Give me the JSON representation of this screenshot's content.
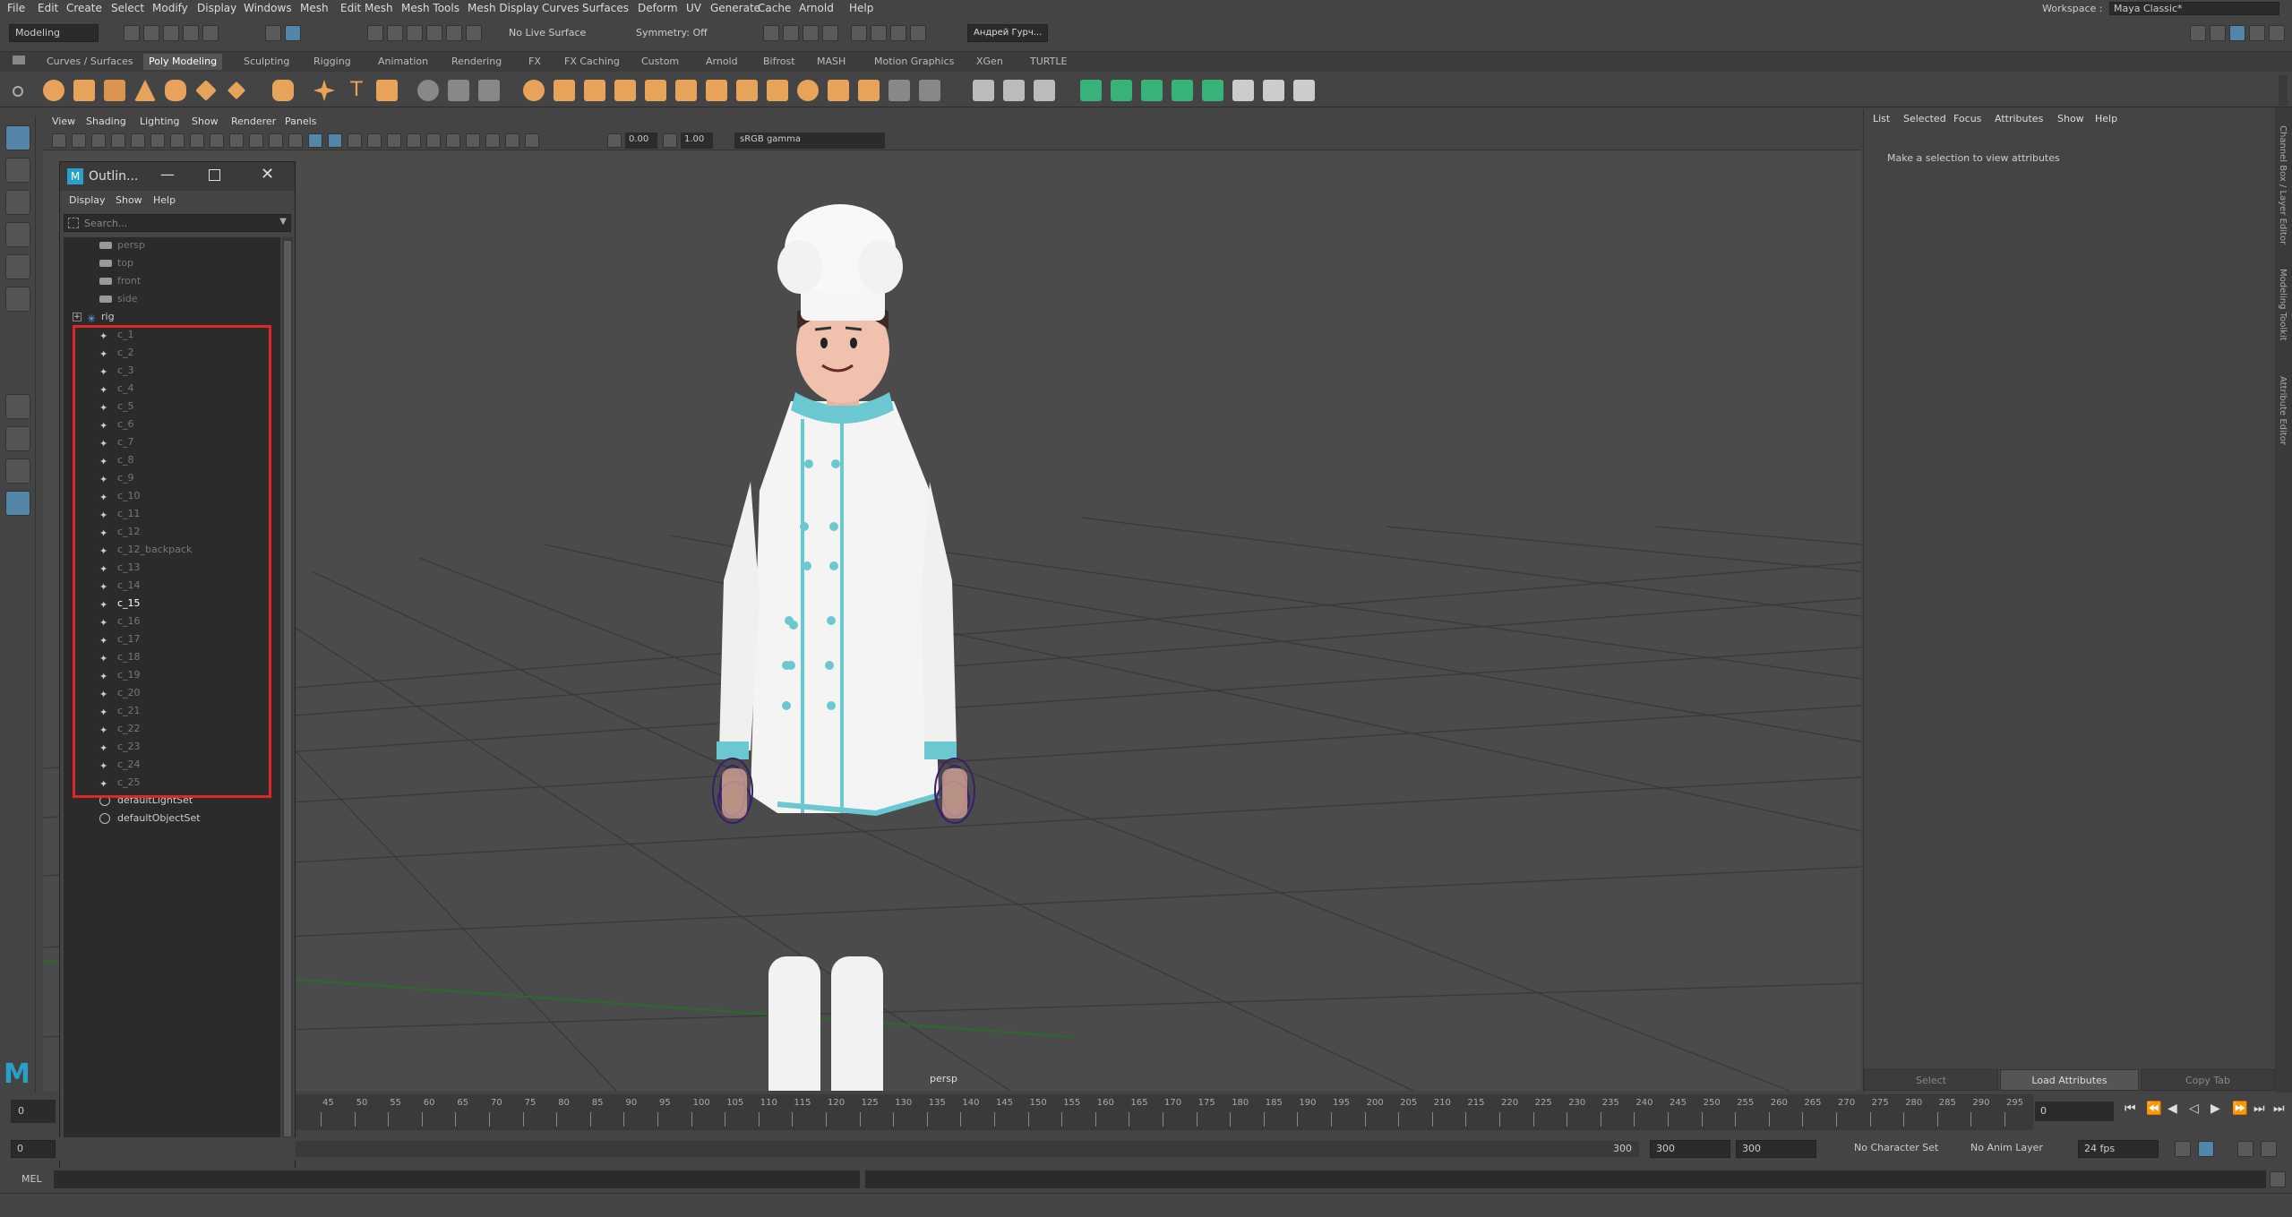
{
  "menubar": {
    "items": [
      "File",
      "Edit",
      "Create",
      "Select",
      "Modify",
      "Display",
      "Windows",
      "Mesh",
      "Edit Mesh",
      "Mesh Tools",
      "Mesh Display",
      "Curves",
      "Surfaces",
      "Deform",
      "UV",
      "Generate",
      "Cache",
      "Arnold",
      "Help"
    ],
    "workspace_label": "Workspace :",
    "workspace_value": "Maya Classic*"
  },
  "status_line": {
    "mode": "Modeling",
    "live_surface": "No Live Surface",
    "symmetry": "Symmetry: Off",
    "user": "Андрей Гурч..."
  },
  "shelf": {
    "tabs": [
      "Curves / Surfaces",
      "Poly Modeling",
      "Sculpting",
      "Rigging",
      "Animation",
      "Rendering",
      "FX",
      "FX Caching",
      "Custom",
      "Arnold",
      "Bifrost",
      "MASH",
      "Motion Graphics",
      "XGen",
      "TURTLE"
    ],
    "active_tab": "Poly Modeling",
    "icon_color": "#e8a35a",
    "accent_green": "#37b37a"
  },
  "panel_menu": [
    "View",
    "Shading",
    "Lighting",
    "Show",
    "Renderer",
    "Panels"
  ],
  "panel_toolbar": {
    "field_a": "0.00",
    "field_b": "1.00",
    "color_space": "sRGB gamma"
  },
  "viewport": {
    "camera_label": "persp",
    "background": "#4b4b4b"
  },
  "outliner": {
    "title": "Outlin...",
    "menu": [
      "Display",
      "Show",
      "Help"
    ],
    "search_placeholder": "Search...",
    "items": [
      {
        "label": "persp",
        "type": "camera",
        "style": "dim"
      },
      {
        "label": "top",
        "type": "camera",
        "style": "dim"
      },
      {
        "label": "front",
        "type": "camera",
        "style": "dim"
      },
      {
        "label": "side",
        "type": "camera",
        "style": "dim"
      },
      {
        "label": "rig",
        "type": "group",
        "style": "normal"
      },
      {
        "label": "c_1",
        "type": "ctrl",
        "style": "dim"
      },
      {
        "label": "c_2",
        "type": "ctrl",
        "style": "dim"
      },
      {
        "label": "c_3",
        "type": "ctrl",
        "style": "dim"
      },
      {
        "label": "c_4",
        "type": "ctrl",
        "style": "dim"
      },
      {
        "label": "c_5",
        "type": "ctrl",
        "style": "dim"
      },
      {
        "label": "c_6",
        "type": "ctrl",
        "style": "dim"
      },
      {
        "label": "c_7",
        "type": "ctrl",
        "style": "dim"
      },
      {
        "label": "c_8",
        "type": "ctrl",
        "style": "dim"
      },
      {
        "label": "c_9",
        "type": "ctrl",
        "style": "dim"
      },
      {
        "label": "c_10",
        "type": "ctrl",
        "style": "dim"
      },
      {
        "label": "c_11",
        "type": "ctrl",
        "style": "dim"
      },
      {
        "label": "c_12",
        "type": "ctrl",
        "style": "dim"
      },
      {
        "label": "c_12_backpack",
        "type": "ctrl",
        "style": "dim"
      },
      {
        "label": "c_13",
        "type": "ctrl",
        "style": "dim"
      },
      {
        "label": "c_14",
        "type": "ctrl",
        "style": "dim"
      },
      {
        "label": "c_15",
        "type": "ctrl",
        "style": "bright"
      },
      {
        "label": "c_16",
        "type": "ctrl",
        "style": "dim"
      },
      {
        "label": "c_17",
        "type": "ctrl",
        "style": "dim"
      },
      {
        "label": "c_18",
        "type": "ctrl",
        "style": "dim"
      },
      {
        "label": "c_19",
        "type": "ctrl",
        "style": "dim"
      },
      {
        "label": "c_20",
        "type": "ctrl",
        "style": "dim"
      },
      {
        "label": "c_21",
        "type": "ctrl",
        "style": "dim"
      },
      {
        "label": "c_22",
        "type": "ctrl",
        "style": "dim"
      },
      {
        "label": "c_23",
        "type": "ctrl",
        "style": "dim"
      },
      {
        "label": "c_24",
        "type": "ctrl",
        "style": "dim"
      },
      {
        "label": "c_25",
        "type": "ctrl",
        "style": "dim"
      },
      {
        "label": "defaultLightSet",
        "type": "set",
        "style": "normal"
      },
      {
        "label": "defaultObjectSet",
        "type": "set",
        "style": "normal"
      }
    ],
    "highlight_color": "#e0262a"
  },
  "attribute_editor": {
    "menu": [
      "List",
      "Selected",
      "Focus",
      "Attributes",
      "Show",
      "Help"
    ],
    "message": "Make a selection to view attributes",
    "buttons": {
      "select": "Select",
      "load": "Load Attributes",
      "copy": "Copy Tab"
    },
    "side_tabs": [
      "Channel Box / Layer Editor",
      "Modeling Toolkit",
      "Attribute Editor"
    ]
  },
  "timeline": {
    "ticks": [
      "45",
      "50",
      "55",
      "60",
      "65",
      "70",
      "75",
      "80",
      "85",
      "90",
      "95",
      "100",
      "105",
      "110",
      "115",
      "120",
      "125",
      "130",
      "135",
      "140",
      "145",
      "150",
      "155",
      "160",
      "165",
      "170",
      "175",
      "180",
      "185",
      "190",
      "195",
      "200",
      "205",
      "210",
      "215",
      "220",
      "225",
      "230",
      "235",
      "240",
      "245",
      "250",
      "255",
      "260",
      "265",
      "270",
      "275",
      "280",
      "285",
      "290",
      "295"
    ],
    "start_field": "0",
    "current_frame": "0"
  },
  "range": {
    "start": "0",
    "range_end": "300",
    "end_a": "300",
    "end_b": "300",
    "character_set": "No Character Set",
    "anim_layer": "No Anim Layer",
    "fps": "24 fps"
  },
  "command_line": {
    "label": "MEL"
  }
}
